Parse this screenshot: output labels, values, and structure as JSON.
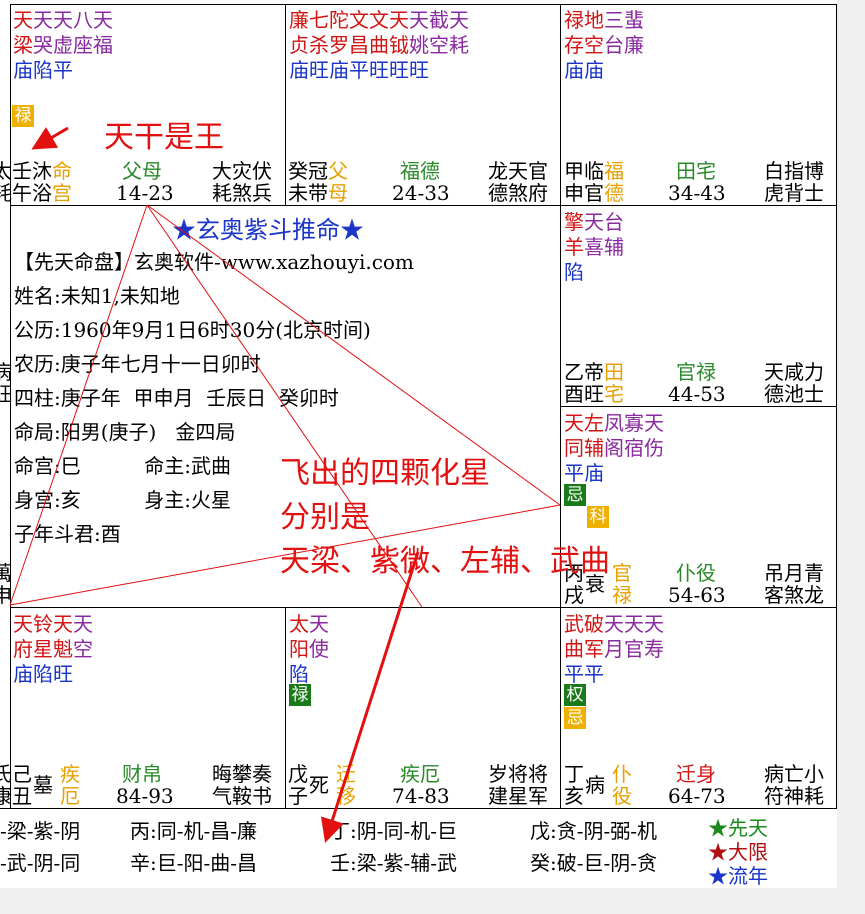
{
  "palaces": {
    "si": {
      "stars": [
        [
          "天",
          "天",
          "天",
          "八",
          "天"
        ],
        [
          "梁",
          "哭",
          "虚",
          "座",
          "福"
        ],
        [
          "庙",
          "陷",
          "平"
        ]
      ],
      "badges": [
        "禄"
      ],
      "stem": "壬",
      "branch": "午",
      "life1": "沐",
      "life2": "浴",
      "tag1": "命",
      "tag2": "宫",
      "name": "父母",
      "range": "14-23",
      "gods1": "大灾伏",
      "gods2": "耗煞兵",
      "edge1": "太",
      "edge2": "耗"
    },
    "wu": {
      "stars": [
        [
          "廉",
          "七",
          "陀",
          "文",
          "文",
          "天",
          "天",
          "截",
          "天"
        ],
        [
          "贞",
          "杀",
          "罗",
          "昌",
          "曲",
          "钺",
          "姚",
          "空",
          "耗"
        ],
        [
          "庙",
          "旺",
          "庙",
          "平",
          "旺",
          "旺",
          "旺"
        ]
      ],
      "stem": "癸",
      "branch": "未",
      "life1": "冠",
      "life2": "带",
      "tag1": "父",
      "tag2": "母",
      "name": "福德",
      "range": "24-33",
      "gods1": "龙天官",
      "gods2": "德煞府"
    },
    "wei": {
      "stars": [
        [
          "禄",
          "地",
          "三",
          "蜚"
        ],
        [
          "存",
          "空",
          "台",
          "廉"
        ],
        [
          "庙",
          "庙"
        ]
      ],
      "stem": "甲",
      "branch": "申",
      "life1": "临",
      "life2": "官",
      "tag1": "福",
      "tag2": "德",
      "name": "田宅",
      "range": "34-43",
      "gods1": "白指博",
      "gods2": "虎背士"
    },
    "you": {
      "stars": [
        [
          "擎",
          "天",
          "台"
        ],
        [
          "羊",
          "喜",
          "辅"
        ],
        [
          "陷"
        ]
      ],
      "stem": "乙",
      "branch": "酉",
      "life1": "帝",
      "life2": "旺",
      "tag1": "田",
      "tag2": "宅",
      "name": "官禄",
      "range": "44-53",
      "gods1": "天咸力",
      "gods2": "德池士"
    },
    "xu": {
      "stars": [
        [
          "天",
          "左",
          "凤",
          "寡",
          "天"
        ],
        [
          "同",
          "辅",
          "阁",
          "宿",
          "伤"
        ],
        [
          "平",
          "庙"
        ]
      ],
      "badges": [
        "忌",
        "科"
      ],
      "stem": "丙",
      "branch": "戌",
      "life1": "衰",
      "tag1": "官",
      "tag2": "禄",
      "name": "仆役",
      "range": "54-63",
      "gods1": "吊月青",
      "gods2": "客煞龙"
    },
    "hai": {
      "stars": [
        [
          "武",
          "破",
          "天",
          "天",
          "天"
        ],
        [
          "曲",
          "军",
          "月",
          "官",
          "寿"
        ],
        [
          "平",
          "平"
        ]
      ],
      "badges": [
        "权",
        "忌"
      ],
      "stem": "丁",
      "branch": "亥",
      "life1": "病",
      "tag1": "仆",
      "tag2": "役",
      "name": "迁身",
      "range": "64-73",
      "gods1": "病亡小",
      "gods2": "符神耗"
    },
    "zi": {
      "stars": [
        [
          "太",
          "天"
        ],
        [
          "阳",
          "使"
        ],
        [
          "陷"
        ]
      ],
      "badges": [
        "禄"
      ],
      "stem": "戊",
      "branch": "子",
      "life1": "死",
      "tag1": "迁",
      "tag2": "移",
      "name": "疾厄",
      "range": "74-83",
      "gods1": "岁将将",
      "gods2": "建星军"
    },
    "chou": {
      "stars": [
        [
          "天",
          "铃",
          "天",
          "天"
        ],
        [
          "府",
          "星",
          "魁",
          "空"
        ],
        [
          "庙",
          "陷",
          "旺"
        ]
      ],
      "stem": "己",
      "branch": "丑",
      "life1": "墓",
      "tag1": "疾",
      "tag2": "厄",
      "name": "财帛",
      "range": "84-93",
      "gods1": "晦攀奏",
      "gods2": "气鞍书",
      "edge1": "氏",
      "edge2": "康"
    },
    "left_edge": {
      "chen1": "病",
      "chen2": "玨",
      "yin1": "萬",
      "yin2": "申"
    }
  },
  "center": {
    "title": "★玄奥紫斗推命★",
    "lines": [
      "【先天命盘】玄奥软件-www.xazhouyi.com",
      "姓名:未知1,未知地",
      "公历:1960年9月1日6时30分(北京时间)",
      "农历:庚子年七月十一日卯时",
      "四柱:庚子年  甲申月  壬辰日  癸卯时",
      "命局:阳男(庚子)   金四局",
      "命宫:巳          命主:武曲",
      "身宫:亥          身主:火星",
      "子年斗君:酉"
    ]
  },
  "footer": {
    "row1": [
      "-梁-紫-阴",
      "丙:同-机-昌-廉",
      "丁:阴-同-机-巨",
      "戊:贪-阴-弼-机"
    ],
    "row2": [
      "-武-阴-同",
      "辛:巨-阳-曲-昌",
      "壬:梁-紫-辅-武",
      "癸:破-巨-阴-贪"
    ],
    "legend": [
      "★先天",
      "★大限",
      "★流年"
    ],
    "legend_colors": [
      "#1a8a1a",
      "#b01010",
      "#1a35c8"
    ]
  },
  "annotations": {
    "tiangan": "天干是王",
    "hua1": "飞出的四颗化星",
    "hua2": "分别是",
    "hua3": "天梁、紫微、左辅、武曲"
  },
  "colors": {
    "annotation": "#e31010",
    "grid": "#000000"
  }
}
